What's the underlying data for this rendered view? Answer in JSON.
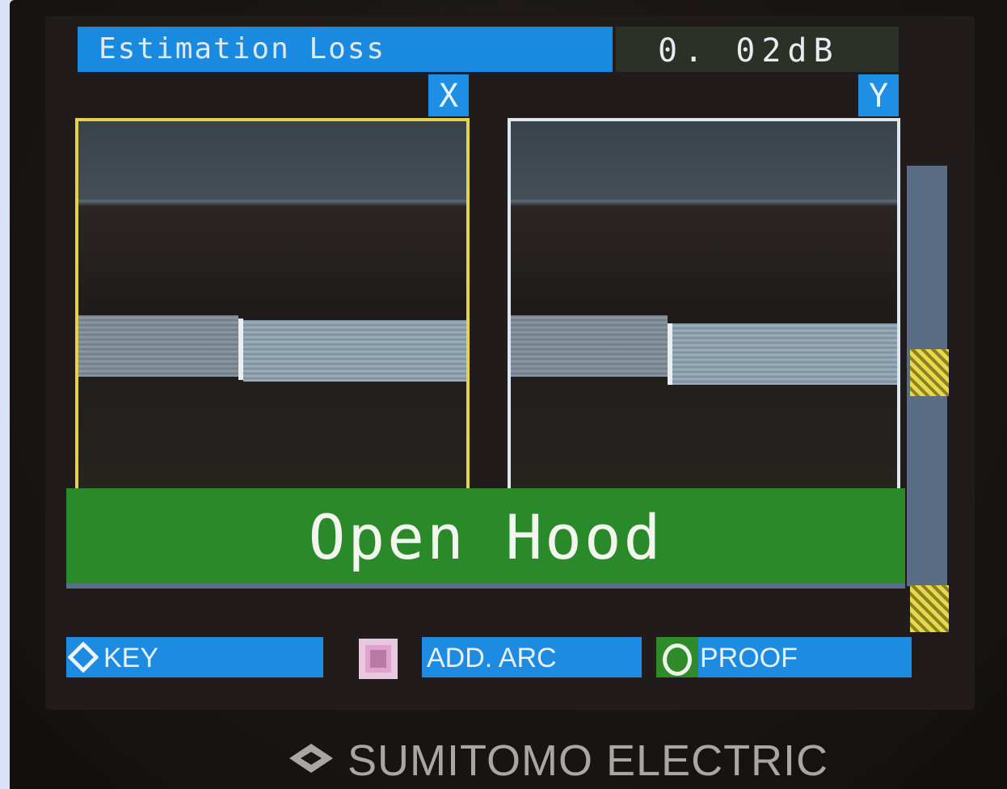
{
  "header": {
    "estimation_label": "Estimation Loss",
    "loss_value": "0. 02dB"
  },
  "views": {
    "x_label": "X",
    "y_label": "Y"
  },
  "message": {
    "text": "Open Hood"
  },
  "softkeys": {
    "key_label": "KEY",
    "add_arc_label": "ADD. ARC",
    "proof_label": "PROOF"
  },
  "brand": {
    "name": "SUMITOMO ELECTRIC"
  },
  "colors": {
    "accent_blue": "#1a8ae0",
    "message_green": "#2a8a29",
    "view_x_border": "#e5d04f",
    "view_y_border": "#dde7ef"
  },
  "icons": [
    "diamond-icon",
    "square-icon",
    "circle-icon",
    "sumitomo-logo-icon"
  ]
}
